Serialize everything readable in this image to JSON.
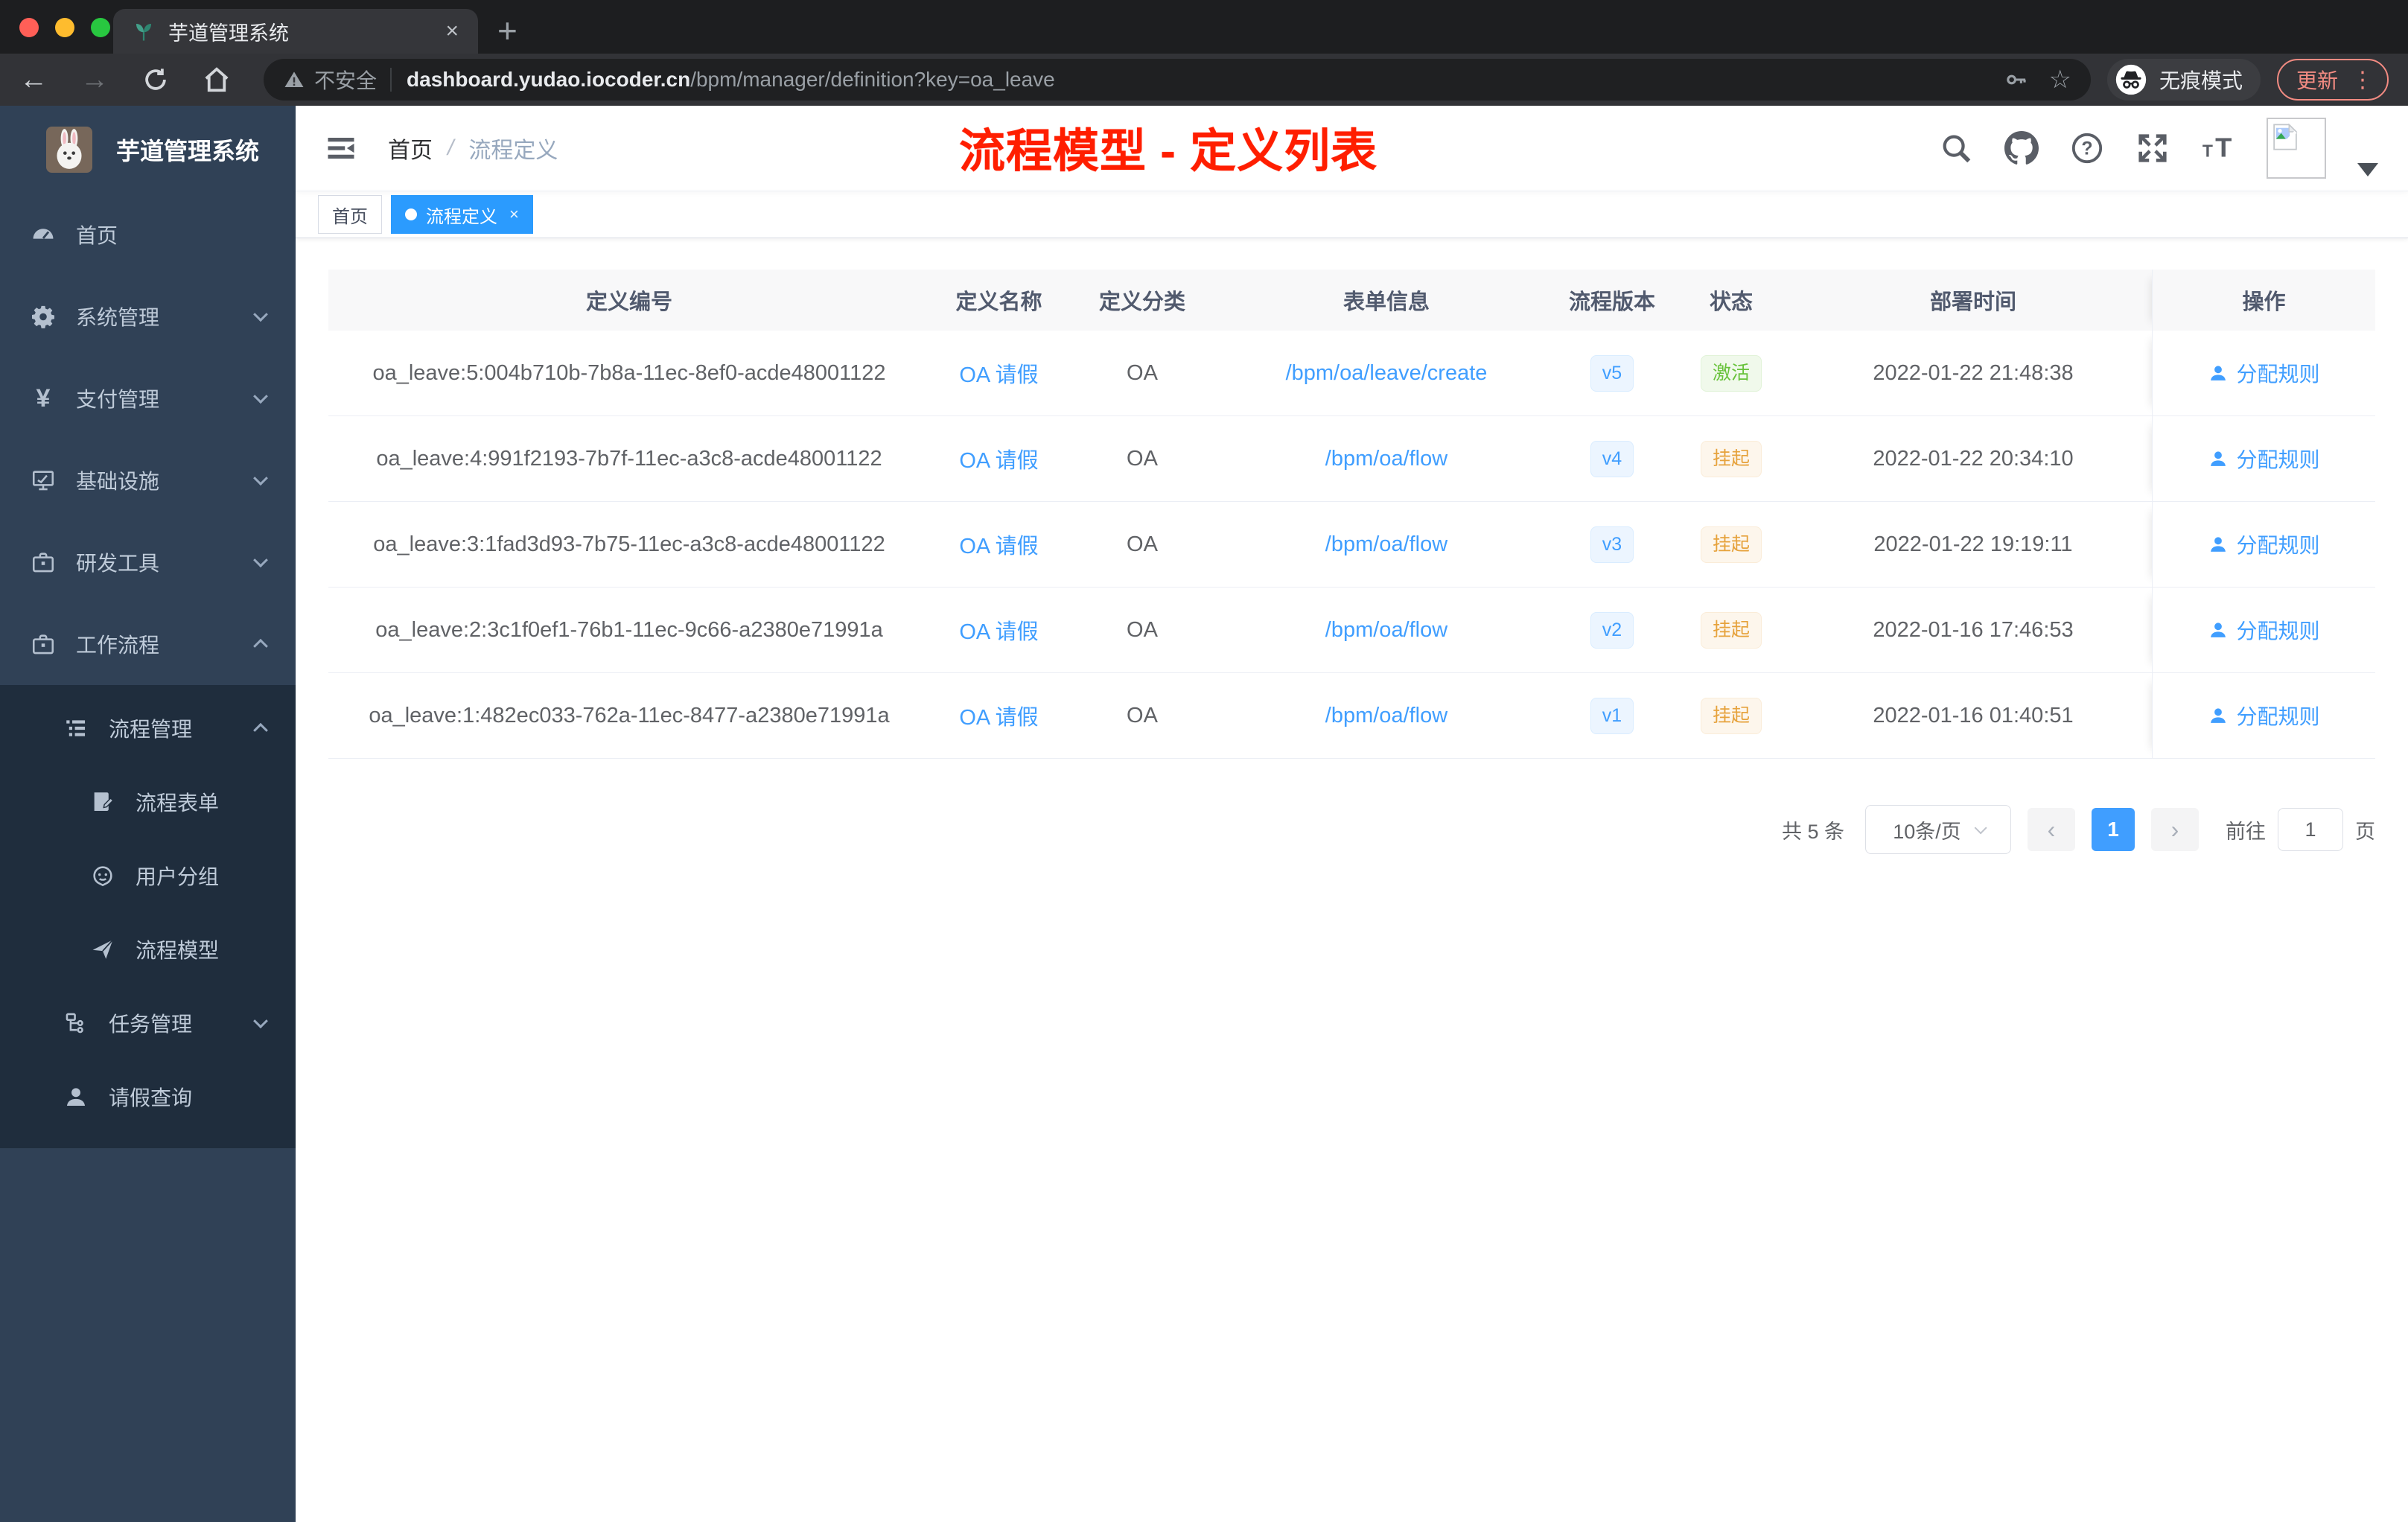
{
  "browser": {
    "tab_title": "芋道管理系统",
    "close_glyph": "×",
    "new_tab_glyph": "+",
    "back_glyph": "←",
    "forward_glyph": "→",
    "security_label": "不安全",
    "url_host": "dashboard.yudao.iocoder.cn",
    "url_path": "/bpm/manager/definition?key=oa_leave",
    "star_glyph": "☆",
    "incognito_label": "无痕模式",
    "update_label": "更新",
    "menu_glyph": "⋮"
  },
  "sidebar": {
    "logo_title": "芋道管理系统",
    "items": [
      {
        "label": "首页"
      },
      {
        "label": "系统管理"
      },
      {
        "label": "支付管理"
      },
      {
        "label": "基础设施"
      },
      {
        "label": "研发工具"
      },
      {
        "label": "工作流程"
      },
      {
        "label": "流程管理"
      },
      {
        "label": "流程表单"
      },
      {
        "label": "用户分组"
      },
      {
        "label": "流程模型"
      },
      {
        "label": "任务管理"
      },
      {
        "label": "请假查询"
      }
    ]
  },
  "header": {
    "breadcrumb_home": "首页",
    "breadcrumb_separator": "/",
    "breadcrumb_current": "流程定义",
    "annotation": "流程模型 - 定义列表"
  },
  "tags": [
    {
      "label": "首页"
    },
    {
      "label": "流程定义",
      "close_glyph": "×"
    }
  ],
  "table": {
    "columns": [
      "定义编号",
      "定义名称",
      "定义分类",
      "表单信息",
      "流程版本",
      "状态",
      "部署时间",
      "操作"
    ],
    "action_label": "分配规则",
    "rows": [
      {
        "id": "oa_leave:5:004b710b-7b8a-11ec-8ef0-acde48001122",
        "name": "OA 请假",
        "category": "OA",
        "form": "/bpm/oa/leave/create",
        "version": "v5",
        "status": "激活",
        "time": "2022-01-22 21:48:38"
      },
      {
        "id": "oa_leave:4:991f2193-7b7f-11ec-a3c8-acde48001122",
        "name": "OA 请假",
        "category": "OA",
        "form": "/bpm/oa/flow",
        "version": "v4",
        "status": "挂起",
        "time": "2022-01-22 20:34:10"
      },
      {
        "id": "oa_leave:3:1fad3d93-7b75-11ec-a3c8-acde48001122",
        "name": "OA 请假",
        "category": "OA",
        "form": "/bpm/oa/flow",
        "version": "v3",
        "status": "挂起",
        "time": "2022-01-22 19:19:11"
      },
      {
        "id": "oa_leave:2:3c1f0ef1-76b1-11ec-9c66-a2380e71991a",
        "name": "OA 请假",
        "category": "OA",
        "form": "/bpm/oa/flow",
        "version": "v2",
        "status": "挂起",
        "time": "2022-01-16 17:46:53"
      },
      {
        "id": "oa_leave:1:482ec033-762a-11ec-8477-a2380e71991a",
        "name": "OA 请假",
        "category": "OA",
        "form": "/bpm/oa/flow",
        "version": "v1",
        "status": "挂起",
        "time": "2022-01-16 01:40:51"
      }
    ]
  },
  "pagination": {
    "total": "共 5 条",
    "page_size": "10条/页",
    "prev_glyph": "‹",
    "next_glyph": "›",
    "current_page": "1",
    "goto_label": "前往",
    "goto_value": "1",
    "goto_unit": "页"
  },
  "colors": {
    "accent_blue": "#409eff",
    "sidebar_bg": "#304156",
    "submenu_bg": "#1f2d3d",
    "success_green": "#67c23a",
    "warning_orange": "#e6a23c",
    "annotation_red": "#ff1e00",
    "update_salmon": "#f28b82"
  }
}
